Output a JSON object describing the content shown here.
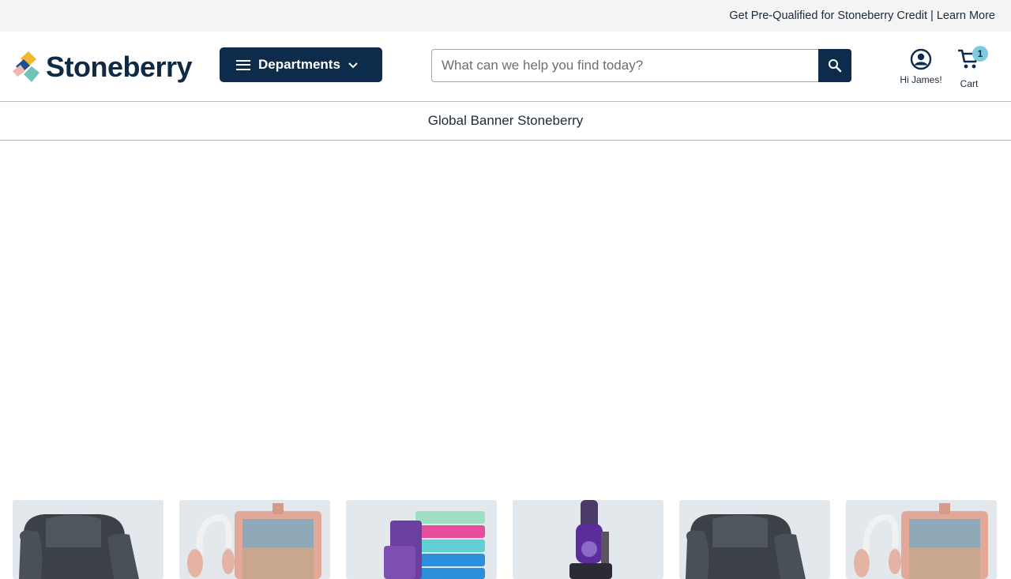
{
  "promo_bar": {
    "text": "Get Pre-Qualified for Stoneberry Credit | Learn More"
  },
  "header": {
    "logo_text": "Stoneberry",
    "departments_label": "Departments",
    "search": {
      "placeholder": "What can we help you find today?",
      "value": ""
    },
    "account_label": "Hi James!",
    "cart_label": "Cart",
    "cart_count": "1"
  },
  "global_banner": {
    "text": "Global Banner Stoneberry"
  },
  "products": [
    {
      "image": "gray-recliner"
    },
    {
      "image": "rose-gold-headphones-tablet-case"
    },
    {
      "image": "bath-towel-set"
    },
    {
      "image": "purple-upright-vacuum"
    },
    {
      "image": "gray-recliner"
    },
    {
      "image": "rose-gold-headphones-tablet-case"
    }
  ],
  "colors": {
    "brand_navy": "#0d2c4c",
    "badge_teal": "#7fcadd",
    "topbar_bg": "#f4f4f4",
    "card_bg": "#e3e8ec"
  }
}
